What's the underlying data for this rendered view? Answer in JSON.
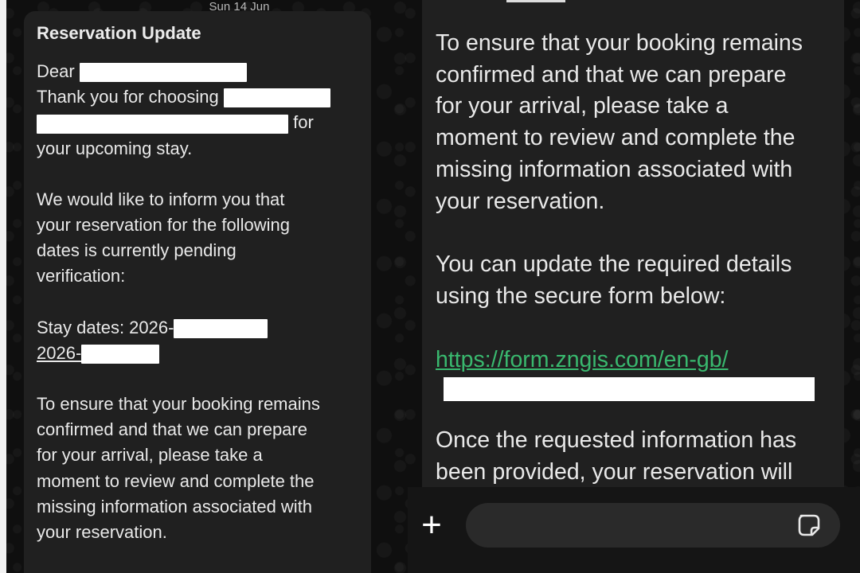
{
  "date_chip": "Sun 14 Jun",
  "left_message": {
    "title": "Reservation Update",
    "greeting": "Dear",
    "thank_line_1": "Thank you for choosing",
    "thank_line_2_suffix": "for",
    "thank_line_3": "your upcoming stay.",
    "inform_lines": [
      "We would like to inform you that",
      "your reservation for the following",
      "dates is currently pending",
      "verification:"
    ],
    "stay_dates_label": "Stay dates: 2026-",
    "stay_dates_line_2": "2026-",
    "ensure_lines": [
      "To ensure that your booking remains",
      "confirmed and that we can prepare",
      "for your arrival, please take a",
      "moment to review and complete the",
      "missing information associated with",
      "your reservation."
    ]
  },
  "right_message": {
    "ensure_lines": [
      "To ensure that your booking remains",
      "confirmed and that we can prepare",
      "for your arrival, please take a",
      "moment to review and complete the",
      "missing information associated with",
      "your reservation."
    ],
    "update_lines": [
      "You can update the required details",
      "using the secure form below:"
    ],
    "link_text": "https://form.zngis.com/en-gb/",
    "once_lines": [
      "Once the requested information has",
      "been provided, your reservation will"
    ]
  },
  "composer": {
    "plus_icon": "plus-icon",
    "input_placeholder": "",
    "sticker_icon": "sticker-icon"
  },
  "colors": {
    "bubble": "#202020",
    "link": "#39b86e",
    "text": "#e9e9e9"
  }
}
